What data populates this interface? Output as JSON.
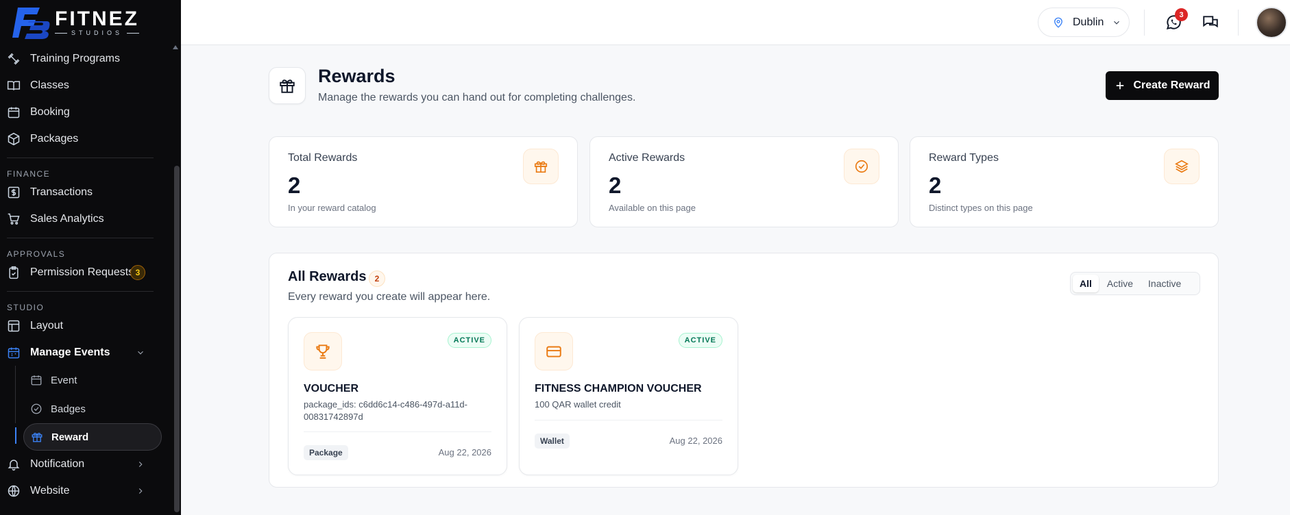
{
  "brand": {
    "name": "FITNEZ",
    "tagline": "STUDIOS"
  },
  "sidebar": {
    "items_top": [
      {
        "label": "Training Programs",
        "icon": "dumbbell-icon"
      },
      {
        "label": "Classes",
        "icon": "book-icon"
      },
      {
        "label": "Booking",
        "icon": "calendar-icon"
      },
      {
        "label": "Packages",
        "icon": "package-icon"
      }
    ],
    "finance_label": "FINANCE",
    "finance": [
      {
        "label": "Transactions",
        "icon": "dollar-icon"
      },
      {
        "label": "Sales Analytics",
        "icon": "cart-icon"
      }
    ],
    "approvals_label": "APPROVALS",
    "approvals": [
      {
        "label": "Permission Requests",
        "count": "3",
        "icon": "clipboard-check-icon"
      }
    ],
    "studio_label": "STUDIO",
    "studio": [
      {
        "label": "Layout",
        "icon": "layout-icon"
      },
      {
        "label": "Manage Events",
        "icon": "calendar-icon"
      }
    ],
    "sub_items": [
      {
        "label": "Event",
        "icon": "calendar-icon"
      },
      {
        "label": "Badges",
        "icon": "check-circle-icon"
      },
      {
        "label": "Reward",
        "icon": "gift-icon"
      }
    ],
    "bottom": [
      {
        "label": "Notification",
        "icon": "bell-icon"
      },
      {
        "label": "Website",
        "icon": "globe-icon"
      }
    ]
  },
  "topbar": {
    "location": "Dublin",
    "whatsapp_count": "3"
  },
  "page": {
    "title": "Rewards",
    "subtitle": "Manage the rewards you can hand out for completing challenges.",
    "create_label": "Create Reward"
  },
  "stats": [
    {
      "label": "Total Rewards",
      "value": "2",
      "hint": "In your reward catalog",
      "icon": "gift-icon"
    },
    {
      "label": "Active Rewards",
      "value": "2",
      "hint": "Available on this page",
      "icon": "check-circle-icon"
    },
    {
      "label": "Reward Types",
      "value": "2",
      "hint": "Distinct types on this page",
      "icon": "layers-icon"
    }
  ],
  "panel": {
    "title": "All Rewards",
    "count": "2",
    "subtitle": "Every reward you create will appear here.",
    "filters": [
      "All",
      "Active",
      "Inactive"
    ]
  },
  "rewards": [
    {
      "title": "VOUCHER",
      "desc": "package_ids: c6dd6c14-c486-497d-a11d-00831742897d",
      "status": "ACTIVE",
      "type": "Package",
      "date": "Aug 22, 2026",
      "icon": "trophy-icon"
    },
    {
      "title": "FITNESS CHAMPION VOUCHER",
      "desc": "100 QAR wallet credit",
      "status": "ACTIVE",
      "type": "Wallet",
      "date": "Aug 22, 2026",
      "icon": "credit-card-icon"
    }
  ],
  "colors": {
    "accent": "#ea7a12",
    "sidebar": "#0b0b0d",
    "active_green": "#047857",
    "nav_blue": "#3b82f6"
  }
}
